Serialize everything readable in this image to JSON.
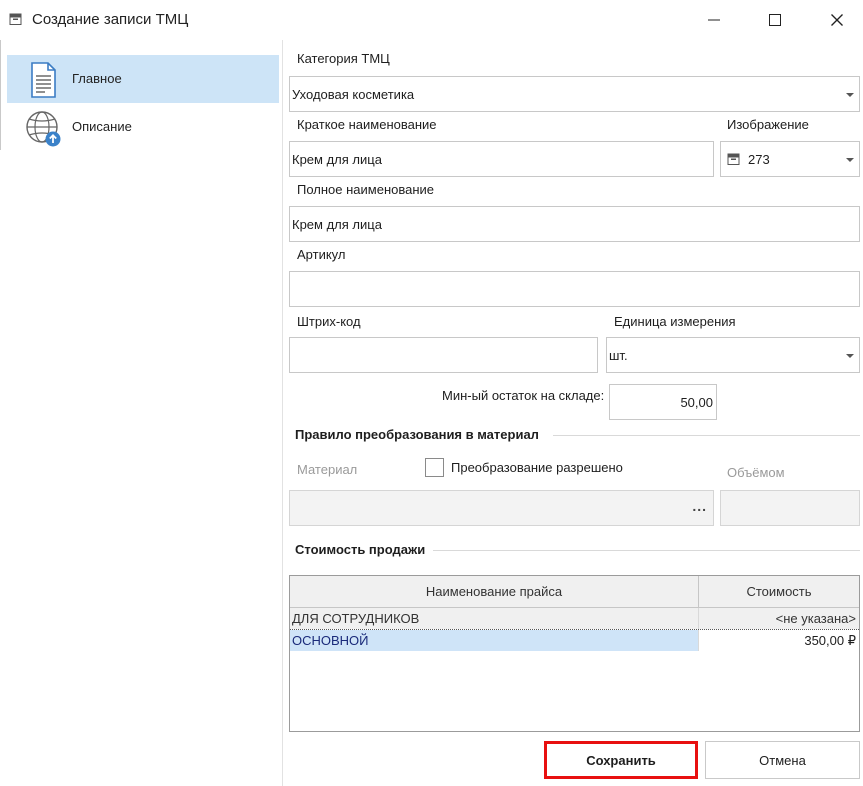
{
  "window": {
    "title": "Создание записи ТМЦ"
  },
  "nav": {
    "items": [
      {
        "label": "Главное",
        "icon": "document-icon",
        "active": true
      },
      {
        "label": "Описание",
        "icon": "globe-upload-icon",
        "active": false
      }
    ]
  },
  "form": {
    "category": {
      "label": "Категория ТМЦ",
      "value": "Уходовая косметика"
    },
    "short_name": {
      "label": "Краткое наименование",
      "value": "Крем для лица"
    },
    "image": {
      "label": "Изображение",
      "value": "273"
    },
    "full_name": {
      "label": "Полное наименование",
      "value": "Крем для лица"
    },
    "article": {
      "label": "Артикул",
      "value": ""
    },
    "barcode": {
      "label": "Штрих-код",
      "value": ""
    },
    "unit": {
      "label": "Единица измерения",
      "value": "шт."
    },
    "min_stock": {
      "label": "Мин-ый остаток на складе:",
      "value": "50,00"
    },
    "conversion": {
      "section_title": "Правило преобразования в материал",
      "material_label": "Материал",
      "allowed_label": "Преобразование разрешено",
      "allowed": false,
      "volume_label": "Объёмом",
      "material_button": "..."
    },
    "pricing": {
      "section_title": "Стоимость продажи",
      "columns": [
        "Наименование прайса",
        "Стоимость"
      ],
      "rows": [
        {
          "name": "ДЛЯ СОТРУДНИКОВ",
          "price": "<не указана>"
        },
        {
          "name": "ОСНОВНОЙ",
          "price": "350,00 ₽"
        }
      ]
    }
  },
  "buttons": {
    "save": "Сохранить",
    "cancel": "Отмена"
  },
  "colors": {
    "nav_active": "#cde4f7",
    "selection": "#cfe4f8",
    "save_highlight": "#e81010"
  }
}
